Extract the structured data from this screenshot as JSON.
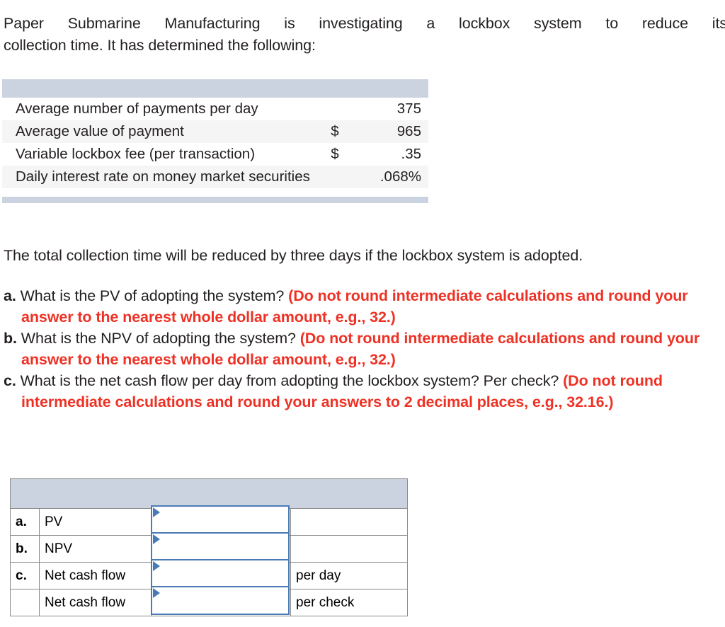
{
  "intro": {
    "line1": "Paper Submarine Manufacturing is investigating a lockbox system to reduce its",
    "line2": "collection time. It has determined the following:"
  },
  "data_table": {
    "rows": [
      {
        "label": "Average number of payments per day",
        "currency": "",
        "value": "375"
      },
      {
        "label": "Average value of payment",
        "currency": "$",
        "value": "965"
      },
      {
        "label": "Variable lockbox fee (per transaction)",
        "currency": "$",
        "value": ".35"
      },
      {
        "label": "Daily interest rate on money market securities",
        "currency": "",
        "value": ".068%"
      }
    ]
  },
  "note": "The total collection time will be reduced by three days if the lockbox system is adopted.",
  "questions": [
    {
      "letter": "a.",
      "text": "What is the PV of adopting the system? ",
      "emphasis": "(Do not round intermediate calculations and round your answer to the nearest whole dollar amount, e.g., 32.)"
    },
    {
      "letter": "b.",
      "text": "What is the NPV of adopting the system? ",
      "emphasis": "(Do not round intermediate calculations and round your answer to the nearest whole dollar amount, e.g., 32.)"
    },
    {
      "letter": "c.",
      "text": "What is the net cash flow per day from adopting the lockbox system? Per check? ",
      "emphasis": "(Do not round intermediate calculations and round your answers to 2 decimal places, e.g., 32.16.)"
    }
  ],
  "answer_table": {
    "header": "",
    "rows": [
      {
        "letter": "a.",
        "label": "PV",
        "value": "",
        "unit": ""
      },
      {
        "letter": "b.",
        "label": "NPV",
        "value": "",
        "unit": ""
      },
      {
        "letter": "c.",
        "label": "Net cash flow",
        "value": "",
        "unit": "per day"
      },
      {
        "letter": "",
        "label": "Net cash flow",
        "value": "",
        "unit": "per check"
      }
    ]
  },
  "colors": {
    "emphasis_red": "#ee3124",
    "table_header_blue_gray": "#ccd3e0",
    "row_shade": "#f5f5f5",
    "input_border_blue": "#4a7ab5",
    "cell_border_gray": "#8a8a8a",
    "text": "#231f20"
  }
}
